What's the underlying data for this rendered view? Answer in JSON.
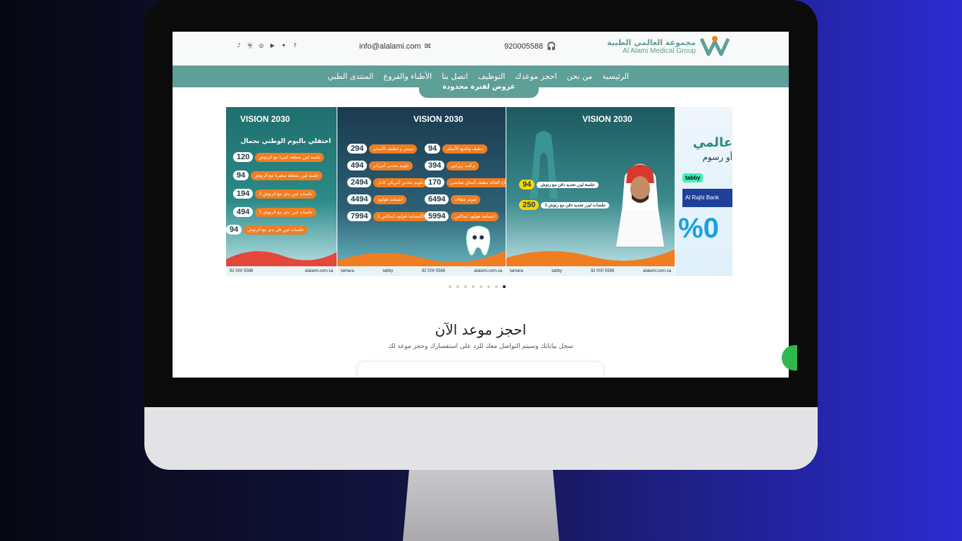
{
  "header": {
    "logo_ar": "مجموعة العالمي الطبية",
    "logo_en": "Al Alami Medical Group",
    "phone": "920005588",
    "email": "info@alalami.com",
    "socials": [
      "facebook-icon",
      "twitter-icon",
      "youtube-icon",
      "instagram-icon",
      "snapchat-icon",
      "tiktok-icon"
    ]
  },
  "nav": {
    "items": [
      "الرئيسية",
      "من نحن",
      "احجز موعدك",
      "التوظيف",
      "اتصل بنا",
      "الأطباء والفروع",
      "المنتدى الطبي"
    ]
  },
  "promo_tab": "عروض لفترة محدودة",
  "slides": {
    "s1": {
      "vision": "VISION 2030",
      "headline": "احتفلي باليوم الوطني بجمال",
      "prices": [
        "120",
        "94",
        "194",
        "494",
        "94"
      ],
      "labels": [
        "جلسة ليزر منطقة كبيرة مع الرتوش",
        "جلسة ليزر منطقة صغيرة مع الرتوش",
        "3 جلسات ليزر بدي مع الرتوش",
        "3 جلسات ليزر بدي مع الرتوش",
        "جلسات ليزر فل بدي مع الرتوش"
      ],
      "phone": "92 000 5588",
      "site": "alalami.com.sa"
    },
    "s2": {
      "vision": "VISION 2030",
      "prices_left": [
        "294",
        "494",
        "2494",
        "4494",
        "7994"
      ],
      "prices_right": [
        "94",
        "394",
        "170",
        "6494",
        "5994"
      ],
      "labels_right": [
        "تنظيف وتلميع الأسنان",
        "تركيب زيركون",
        "تاج الحالة تنظيف أسنان شخصي",
        "تقويم شفاف",
        "ابتسامة هوليود ايماكس"
      ],
      "labels_left": [
        "تبييض و تنظيف الأسنان",
        "تقويم معدني أمريكي",
        "تقويم معدني أمريكي كامل",
        "ابتسامة هوليود",
        "ابتسامة هوليود ايماكس 3D"
      ],
      "phone": "92 000 5588",
      "site": "alalami.com.sa",
      "pay": [
        "tamara",
        "tabby"
      ]
    },
    "s3": {
      "vision": "VISION 2030",
      "prices": [
        "94",
        "250"
      ],
      "labels": [
        "جلسة ليزر تحديد ذقن مع رتوش",
        "3 جلسات ليزر تحديد ذقن مع رتوش"
      ],
      "phone": "92 000 5588",
      "site": "alalami.com.sa",
      "pay": [
        "tamara",
        "tabby"
      ]
    },
    "s4": {
      "headline": "عالمي",
      "sub": "أو رسوم",
      "pay": [
        "tabby"
      ],
      "bank": "Al Rajhi Bank",
      "percent": "%0"
    }
  },
  "carousel": {
    "dots": 8,
    "active": 7
  },
  "booking": {
    "title": "احجز موعد الآن",
    "subtitle": "سجل بياناتك وسيتم التواصل معك للرد على استفسارك وحجز موعد لك"
  },
  "colors": {
    "brand": "#5e9f98",
    "accent": "#f07d22",
    "whatsapp": "#2fb84c"
  }
}
